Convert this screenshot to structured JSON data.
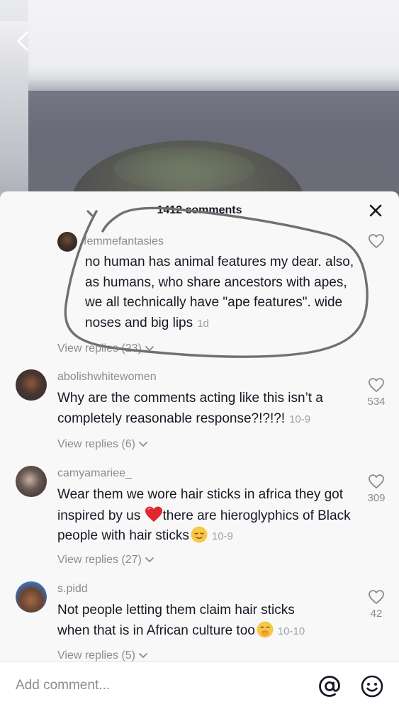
{
  "header": {
    "comment_count": "1412 comments"
  },
  "comments": [
    {
      "username": "femmefantasies",
      "text": "no human has animal features my dear. also, as humans, who share ancestors with apes, we all technically have \"ape features\". wide noses and big lips",
      "timestamp": "1d",
      "replies_label": "View replies (23)",
      "likes": ""
    },
    {
      "username": "abolishwhitewomen",
      "text": "Why are the comments acting like this isn’t a completely reasonable response?!?!?!",
      "timestamp": "10-9",
      "replies_label": "View replies (6)",
      "likes": "534"
    },
    {
      "username": "camyamariee_",
      "text_part1": "Wear them we wore hair sticks in africa they got inspired by us ",
      "text_part2": "there are hieroglyphics of Black people with hair sticks",
      "timestamp": "10-9",
      "replies_label": "View replies (27)",
      "likes": "309"
    },
    {
      "username": "s.pidd",
      "text": "Not people letting them claim hair sticks when that is in African culture too",
      "timestamp": "10-10",
      "replies_label": "View replies (5)",
      "likes": "42"
    }
  ],
  "composer": {
    "placeholder": "Add comment..."
  },
  "icons": {
    "back": "chevron-left-icon",
    "close": "close-icon",
    "like": "heart-outline-icon",
    "mention": "at-sign-icon",
    "emoji": "smiley-icon",
    "chevron": "chevron-down-icon"
  },
  "colors": {
    "sheet_bg": "#f8f8f8",
    "text": "#161823",
    "muted": "#8a8b91",
    "annotation": "#6f6f6f"
  }
}
